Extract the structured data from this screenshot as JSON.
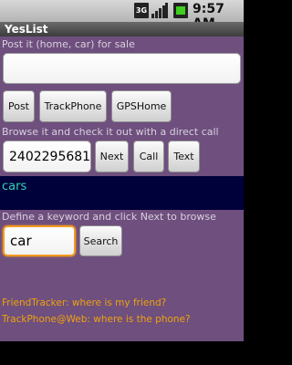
{
  "status": {
    "network": "3G",
    "time": "9:57 AM"
  },
  "app": {
    "title": "YesList"
  },
  "post_section": {
    "label": "Post it (home, car) for sale",
    "input_value": ""
  },
  "buttons": {
    "post": "Post",
    "track_phone": "TrackPhone",
    "gps_home": "GPSHome"
  },
  "call_section": {
    "label": "Browse it and check it out with a direct call",
    "phone_value": "2402295681",
    "next": "Next",
    "call": "Call",
    "text": "Text"
  },
  "result": {
    "text": "cars"
  },
  "keyword_section": {
    "label": "Define a keyword and click Next to browse",
    "keyword_value": "car",
    "search": "Search"
  },
  "links": {
    "friend_tracker": "FriendTracker: where is my friend?",
    "track_phone_web": "TrackPhone@Web: where is the phone?"
  },
  "colors": {
    "background": "#6e4f7e",
    "accent_text": "#f0a20e",
    "result_text": "#2ed5b4",
    "focus": "#f19a22"
  }
}
